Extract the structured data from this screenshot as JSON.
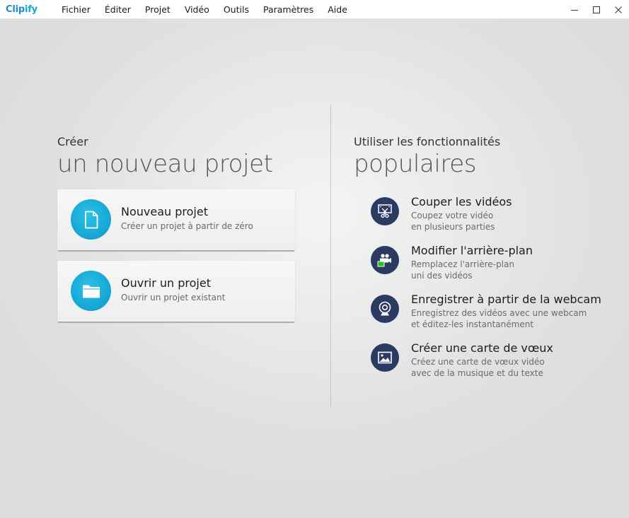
{
  "app": {
    "logo_part1": "Clip",
    "logo_part2": "ify"
  },
  "menu": {
    "items": [
      "Fichier",
      "Éditer",
      "Projet",
      "Vidéo",
      "Outils",
      "Paramètres",
      "Aide"
    ]
  },
  "window_controls": {
    "minimize_icon": "minimize-icon",
    "maximize_icon": "maximize-icon",
    "close_icon": "close-icon"
  },
  "create": {
    "heading_small": "Créer",
    "heading_big": "un nouveau projet",
    "cards": [
      {
        "title": "Nouveau projet",
        "subtitle": "Créer un projet à partir de zéro",
        "icon": "document-icon"
      },
      {
        "title": "Ouvrir un projet",
        "subtitle": "Ouvrir un projet existant",
        "icon": "folder-icon"
      }
    ]
  },
  "features": {
    "heading_small": "Utiliser les fonctionnalités",
    "heading_big": "populaires",
    "items": [
      {
        "title": "Couper les vidéos",
        "desc_line1": "Coupez votre vidéo",
        "desc_line2": "en plusieurs parties",
        "icon": "cut-video-icon"
      },
      {
        "title": "Modifier l'arrière-plan",
        "desc_line1": "Remplacez l'arrière-plan",
        "desc_line2": "uni des vidéos",
        "icon": "chroma-key-icon"
      },
      {
        "title": "Enregistrer à partir de la webcam",
        "desc_line1": "Enregistrez des vidéos avec une webcam",
        "desc_line2": "et éditez-les instantanément",
        "icon": "webcam-icon"
      },
      {
        "title": "Créer une carte de vœux",
        "desc_line1": "Créez une carte de vœux vidéo",
        "desc_line2": "avec de la musique et du texte",
        "icon": "image-icon"
      }
    ]
  },
  "colors": {
    "accent": "#17a9d6",
    "feature_icon_bg": "#2b3a63",
    "logo": "#1a8fd0"
  }
}
